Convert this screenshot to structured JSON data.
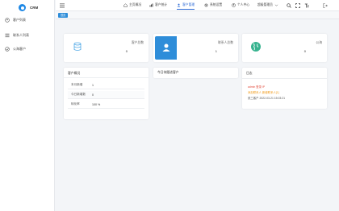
{
  "app": {
    "name": "CRM"
  },
  "sidebar": {
    "items": [
      {
        "label": "客户列表",
        "icon": "users-icon"
      },
      {
        "label": "联系人列表",
        "icon": "list-icon"
      },
      {
        "label": "公海客户",
        "icon": "pool-icon"
      }
    ]
  },
  "topbar": {
    "items": [
      {
        "label": "主页概况",
        "icon": "home-icon"
      },
      {
        "label": "客户统计",
        "icon": "chart-icon"
      },
      {
        "label": "客户管理",
        "icon": "user-icon",
        "active": true
      },
      {
        "label": "系统设置",
        "icon": "settings-icon"
      },
      {
        "label": "个人中心",
        "icon": "person-icon"
      },
      {
        "label": "超级管理员",
        "icon": "chevron-down-icon"
      }
    ]
  },
  "tags": {
    "current": "首页"
  },
  "stats": [
    {
      "label": "客户总数",
      "value": "0",
      "color": "#4ea8e6",
      "icon": "database-icon"
    },
    {
      "label": "联系人总数",
      "value": "1",
      "color": "#2e8dd9",
      "icon": "contact-icon"
    },
    {
      "label": "公海",
      "value": "0",
      "color": "#37b38f",
      "icon": "globe-icon"
    }
  ],
  "overview": {
    "title": "客户概况",
    "rows": [
      {
        "key": "本月新增",
        "value": "1"
      },
      {
        "key": "今日新增数",
        "value": "0"
      },
      {
        "key": "转化率",
        "value": "100 %"
      }
    ]
  },
  "followups": {
    "title": "今日待跟进客户"
  },
  "log": {
    "title": "日志",
    "entries": [
      {
        "text": "admin 登录 IP",
        "level": "red"
      },
      {
        "text": "添加联系人 新增联系人[1]",
        "level": "orange"
      },
      {
        "text": "张三客户 2022-03-21 15:03:21",
        "level": "normal"
      }
    ]
  },
  "colors": {
    "accent": "#2e6bd6",
    "tag": "#2e8dd9"
  }
}
